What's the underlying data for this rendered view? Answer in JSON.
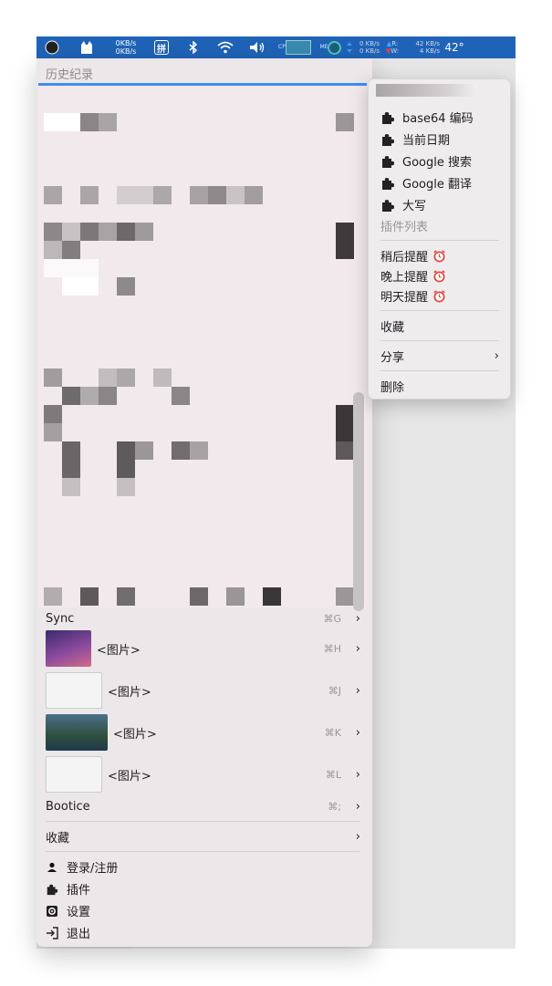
{
  "menubar": {
    "net_up": "0KB/s",
    "net_down": "0KB/s",
    "input_method": "拼",
    "cpu_label": "CPU",
    "mem_label": "MEM",
    "disk_read": "0 KB/s",
    "disk_write": "0 KB/s",
    "r_label": "R:",
    "w_label": "W:",
    "net2_up": "42 KB/s",
    "net2_down": "4 KB/s",
    "temperature": "42°"
  },
  "history": {
    "title": "历史纪录"
  },
  "clips": [
    {
      "label": "Sync",
      "shortcut": "⌘G"
    },
    {
      "label": "<图片>",
      "shortcut": "⌘H"
    },
    {
      "label": "<图片>",
      "shortcut": "⌘J"
    },
    {
      "label": "<图片>",
      "shortcut": "⌘K"
    },
    {
      "label": "<图片>",
      "shortcut": "⌘L"
    },
    {
      "label": "Bootice",
      "shortcut": "⌘;"
    }
  ],
  "favorites": {
    "label": "收藏"
  },
  "account": {
    "login": "登录/注册",
    "plugins": "插件",
    "settings": "设置",
    "quit": "退出"
  },
  "context_menu": {
    "plugins": [
      "base64 编码",
      "当前日期",
      "Google 搜索",
      "Google 翻译",
      "大写"
    ],
    "plugin_list": "插件列表",
    "reminders": [
      "稍后提醒",
      "晚上提醒",
      "明天提醒"
    ],
    "favorite": "收藏",
    "share": "分享",
    "delete": "删除"
  }
}
